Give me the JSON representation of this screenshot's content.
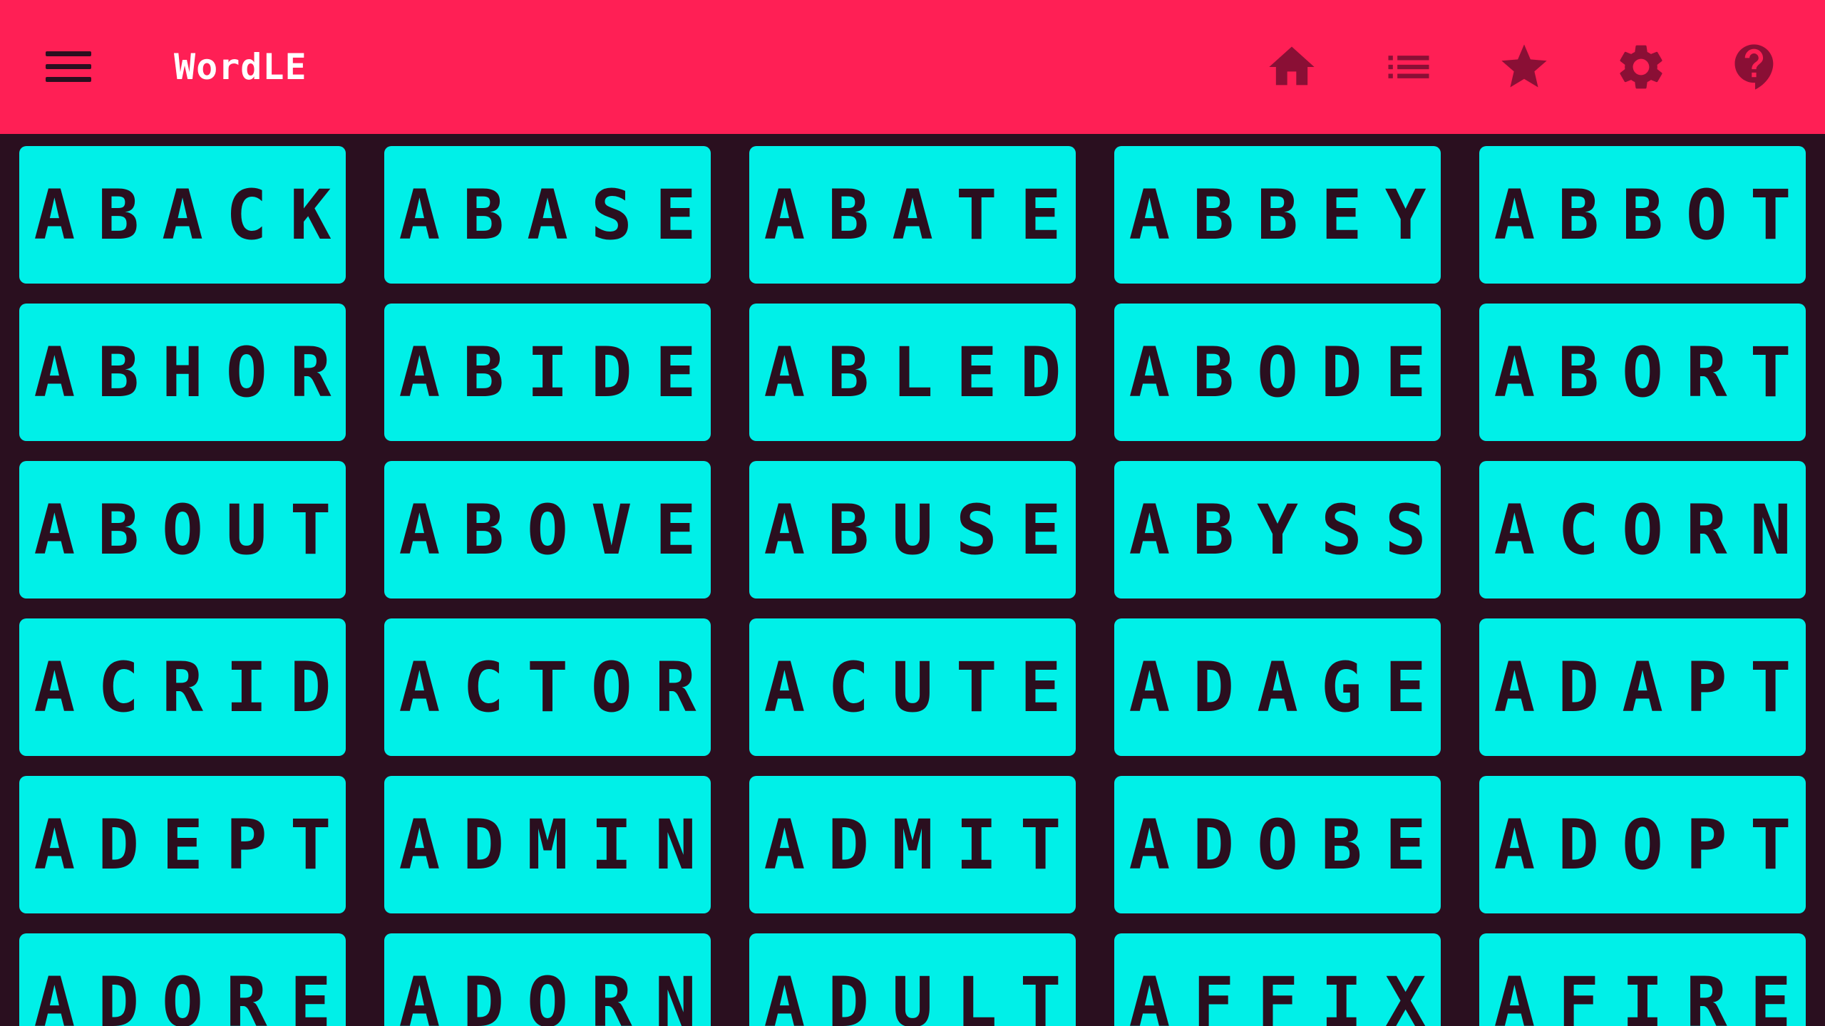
{
  "app": {
    "title": "WordLE"
  },
  "toolbar": {
    "menu_icon": "hamburger-menu-icon",
    "actions": [
      {
        "icon": "home-icon"
      },
      {
        "icon": "list-icon"
      },
      {
        "icon": "star-icon"
      },
      {
        "icon": "gear-icon"
      },
      {
        "icon": "help-icon"
      }
    ]
  },
  "colors": {
    "header": "#ff1f55",
    "background": "#2a0f1f",
    "tile": "#00f0e8",
    "tile_text": "#2a0f1f",
    "icon": "#8a0f35",
    "title_text": "#ffffff"
  },
  "words": [
    "ABACK",
    "ABASE",
    "ABATE",
    "ABBEY",
    "ABBOT",
    "ABHOR",
    "ABIDE",
    "ABLED",
    "ABODE",
    "ABORT",
    "ABOUT",
    "ABOVE",
    "ABUSE",
    "ABYSS",
    "ACORN",
    "ACRID",
    "ACTOR",
    "ACUTE",
    "ADAGE",
    "ADAPT",
    "ADEPT",
    "ADMIN",
    "ADMIT",
    "ADOBE",
    "ADOPT",
    "ADORE",
    "ADORN",
    "ADULT",
    "AFFIX",
    "AFIRE"
  ]
}
